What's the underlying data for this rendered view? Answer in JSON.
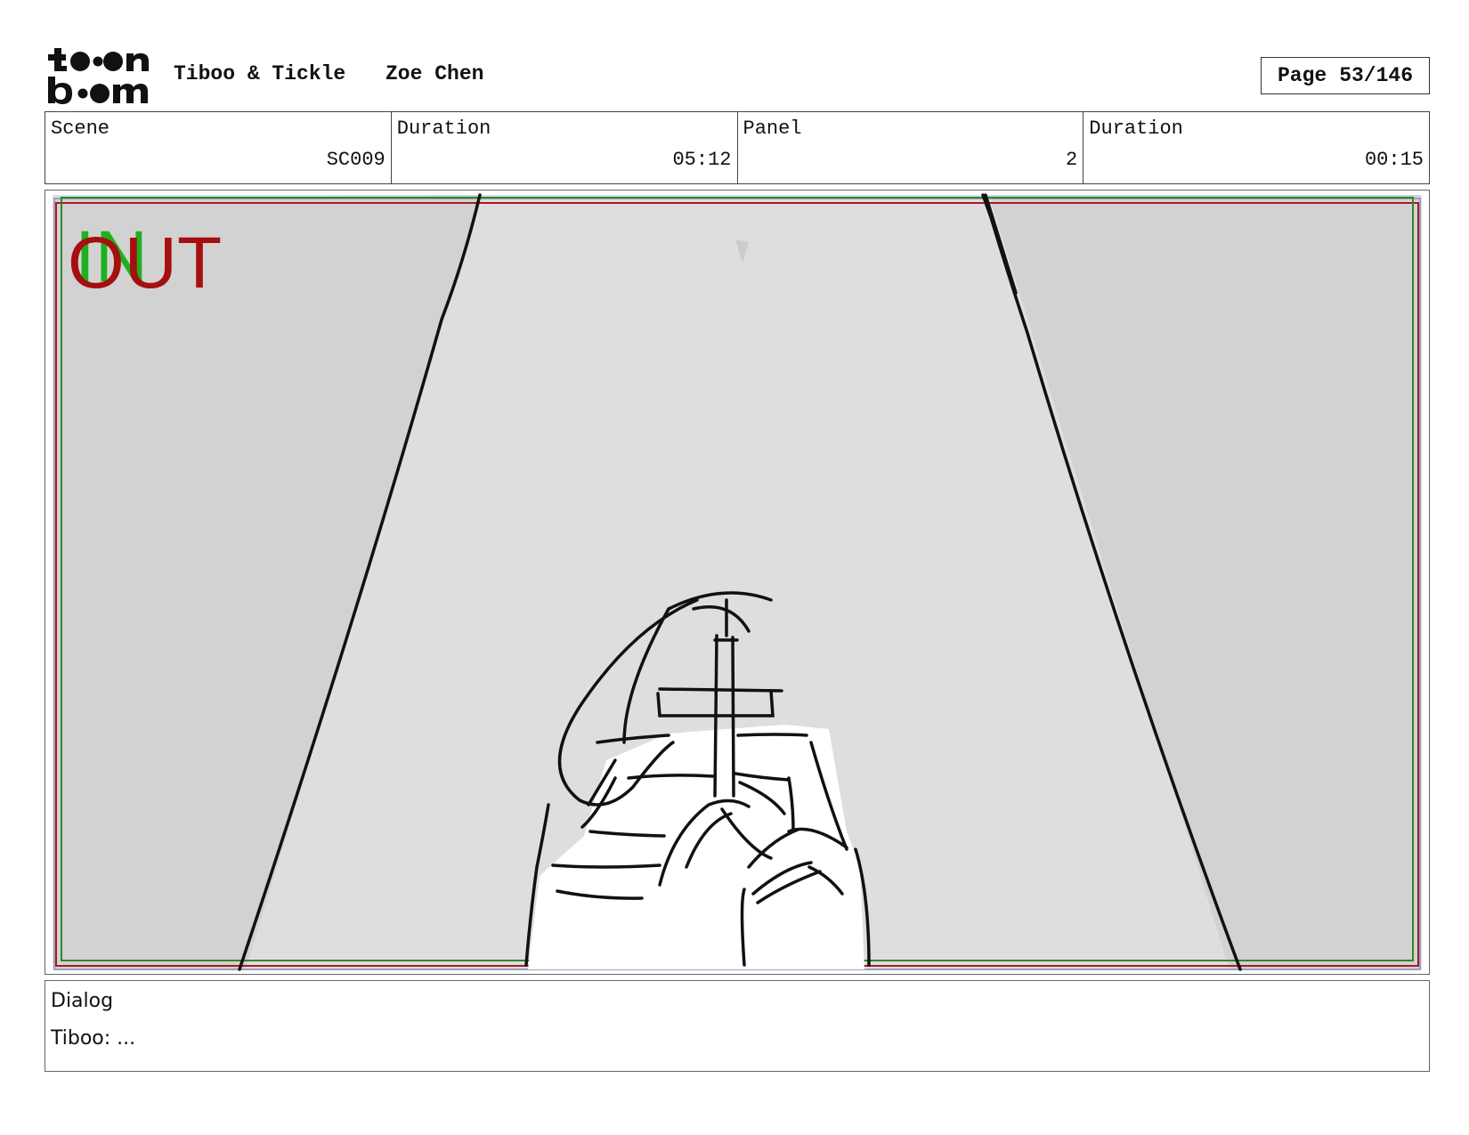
{
  "header": {
    "logo_text": "toon boom",
    "project": "Tiboo & Tickle",
    "author": "Zoe Chen",
    "page_label": "Page",
    "page_value": "53/146"
  },
  "info": [
    {
      "label": "Scene",
      "value": "SC009"
    },
    {
      "label": "Duration",
      "value": "05:12"
    },
    {
      "label": "Panel",
      "value": "2"
    },
    {
      "label": "Duration",
      "value": "00:15"
    }
  ],
  "panel": {
    "in_marker": "IN",
    "out_marker": "OUT",
    "colors": {
      "in": "#1fb01f",
      "out": "#a50f0f",
      "safe_frame": "#2a8a2a",
      "background": "#dedede",
      "side_wall": "#d2d2d2"
    }
  },
  "dialog": {
    "label": "Dialog",
    "text": "Tiboo: ..."
  }
}
